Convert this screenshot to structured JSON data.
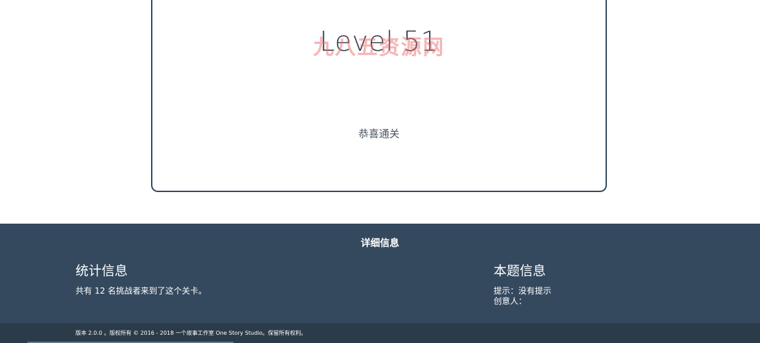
{
  "level": {
    "title": "Level 51",
    "watermark": "九八五资源网",
    "congrats": "恭喜通关"
  },
  "footer": {
    "heading": "详细信息",
    "stats": {
      "title": "统计信息",
      "text": "共有 12 名挑战者来到了这个关卡。"
    },
    "puzzle": {
      "title": "本题信息",
      "hint": "提示：没有提示",
      "creator": "创意人："
    }
  },
  "bottom": {
    "copyright": "版本 2.0.0 。版权所有 © 2016 - 2018 一个故事工作室 One Story Studio。保留所有权利。"
  },
  "colors": {
    "footer_bg": "#34495e",
    "bottom_bg": "#2b3b4a",
    "card_border": "#34495e"
  }
}
